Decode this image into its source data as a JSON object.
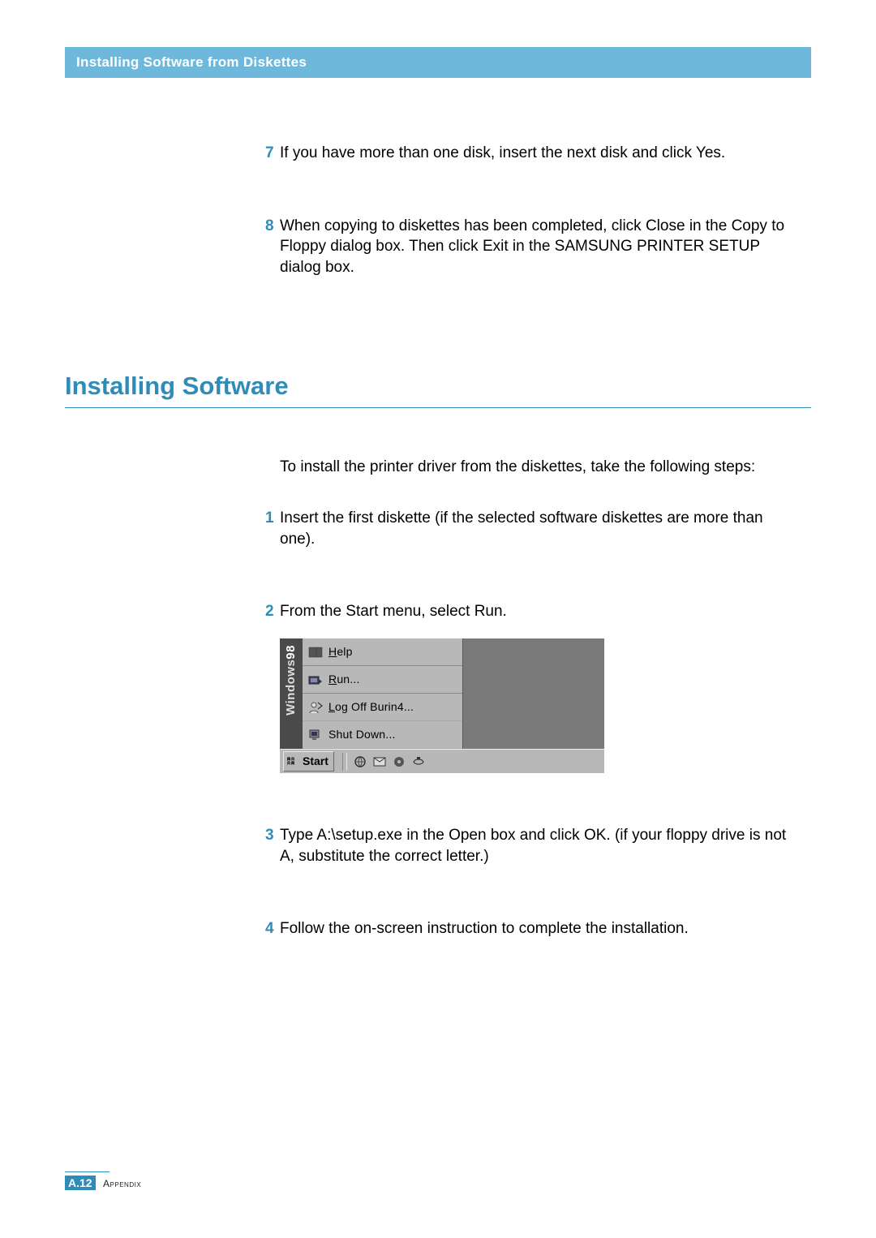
{
  "header": {
    "title": "Installing Software from Diskettes"
  },
  "steps_a": [
    {
      "num": "7",
      "text": "If you have more than one disk, insert the next disk and click Yes."
    },
    {
      "num": "8",
      "text": "When copying to diskettes has been completed, click Close in the Copy to Floppy dialog box. Then click Exit in the SAMSUNG PRINTER SETUP dialog box."
    }
  ],
  "section_heading": "Installing Software",
  "intro_text": "To install the printer driver from the diskettes, take the following steps:",
  "steps_b": [
    {
      "num": "1",
      "text": "Insert the first diskette (if the selected software diskettes are more than one)."
    },
    {
      "num": "2",
      "text": "From the Start menu, select Run."
    },
    {
      "num": "3",
      "text": "Type A:\\setup.exe in the Open box and click OK. (if your floppy drive is not A, substitute the correct letter.)"
    },
    {
      "num": "4",
      "text": "Follow the on-screen instruction to complete the installation."
    }
  ],
  "menu": {
    "brand_a": "Windows",
    "brand_b": "98",
    "item_help": "Help",
    "item_run": "Run...",
    "item_logoff": "Log Off Burin4...",
    "item_shutdown": "Shut Down...",
    "start": "Start"
  },
  "footer": {
    "section": "A",
    "page": "12",
    "label": "Appendix"
  }
}
